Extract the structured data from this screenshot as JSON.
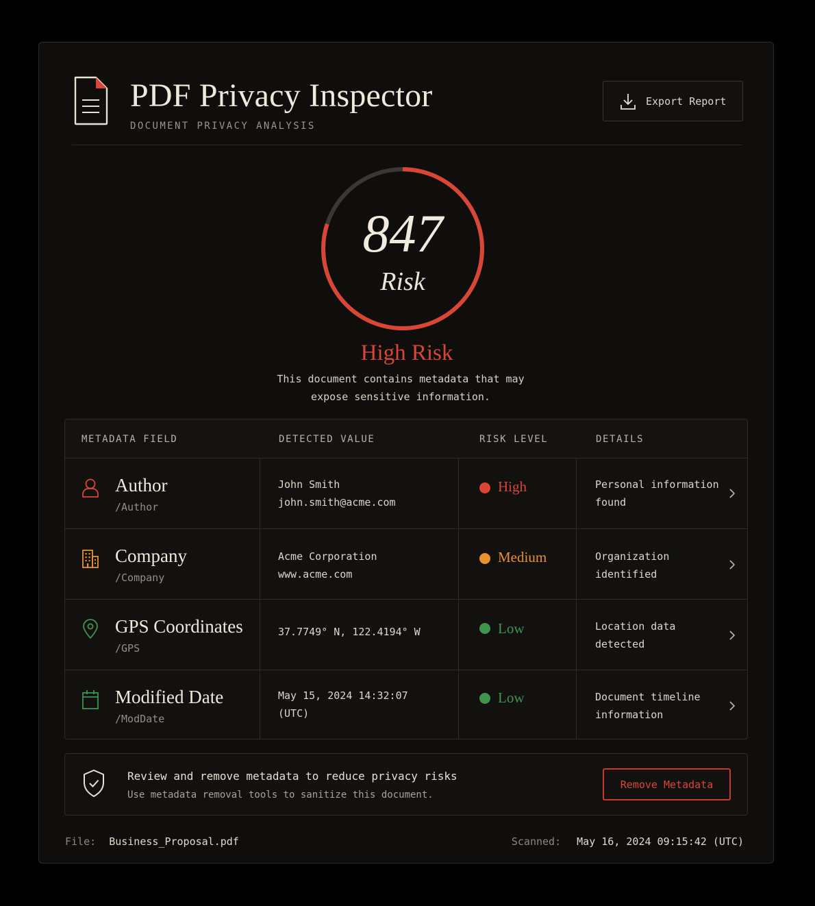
{
  "header": {
    "title": "PDF Privacy Inspector",
    "subtitle": "DOCUMENT PRIVACY ANALYSIS",
    "export_label": "Export Report"
  },
  "score": {
    "value": "847",
    "label": "Risk",
    "gauge_fill_fraction": 0.8,
    "risk_title": "High Risk",
    "description_line1": "This document contains metadata that may",
    "description_line2": "expose sensitive information."
  },
  "table": {
    "headers": [
      "METADATA FIELD",
      "DETECTED VALUE",
      "RISK LEVEL",
      "DETAILS"
    ],
    "rows": [
      {
        "icon": "user-icon",
        "field": "Author",
        "key": "/Author",
        "value_line1": "John Smith",
        "value_line2": "john.smith@acme.com",
        "risk": "High",
        "risk_color": "#d94636",
        "details_line1": "Personal information",
        "details_line2": "found"
      },
      {
        "icon": "building-icon",
        "field": "Company",
        "key": "/Company",
        "value_line1": "Acme Corporation",
        "value_line2": "www.acme.com",
        "risk": "Medium",
        "risk_color": "#e8922e",
        "details_line1": "Organization",
        "details_line2": "identified"
      },
      {
        "icon": "map-pin-icon",
        "field": "GPS Coordinates",
        "key": "/GPS",
        "value_line1": "37.7749° N, 122.4194° W",
        "value_line2": "",
        "risk": "Low",
        "risk_color": "#3f9450",
        "details_line1": "Location data",
        "details_line2": "detected"
      },
      {
        "icon": "calendar-icon",
        "field": "Modified Date",
        "key": "/ModDate",
        "value_line1": "May 15, 2024 14:32:07",
        "value_line2": "(UTC)",
        "risk": "Low",
        "risk_color": "#3f9450",
        "details_line1": "Document timeline",
        "details_line2": "information"
      }
    ]
  },
  "banner": {
    "title": "Review and remove metadata to reduce privacy risks",
    "subtitle": "Use metadata removal tools to sanitize this document.",
    "button_label": "Remove Metadata"
  },
  "footer": {
    "file_key": "File:",
    "file_value": "Business_Proposal.pdf",
    "scanned_key": "Scanned:",
    "scanned_value": "May 16, 2024 09:15:42 (UTC)"
  },
  "colors": {
    "accent_red": "#d94636",
    "medium_orange": "#e8922e",
    "low_green": "#3f9450",
    "background": "#0f0e0d"
  }
}
